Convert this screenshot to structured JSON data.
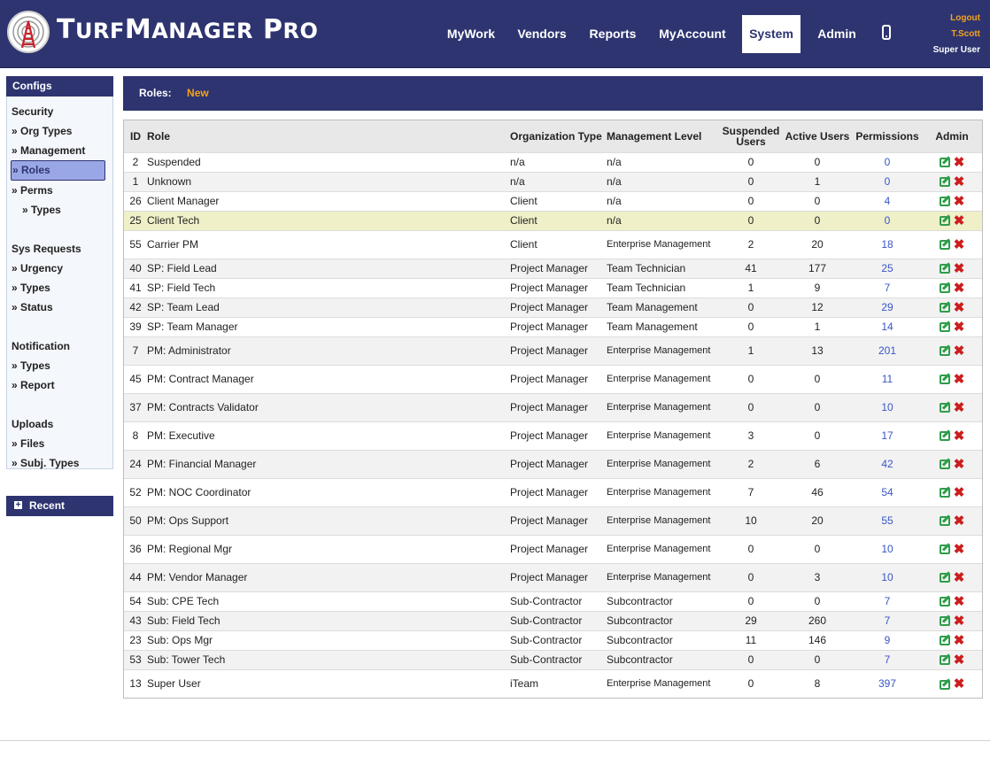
{
  "app": {
    "brand_big1": "T",
    "brand_small1": "URF",
    "brand_big2": "M",
    "brand_small2": "ANAGER",
    "brand_big3": "P",
    "brand_small3": "RO",
    "accent_color": "#f5a21b",
    "nav_bg": "#2d3470"
  },
  "nav": {
    "mywork": "MyWork",
    "vendors": "Vendors",
    "reports": "Reports",
    "myaccount": "MyAccount",
    "system": "System",
    "admin": "Admin",
    "phone_icon": "mobile-phone-icon"
  },
  "user": {
    "logout": "Logout",
    "name": "T.Scott",
    "role": "Super User"
  },
  "sidebar": {
    "header": "Configs",
    "security": "Security",
    "org_types": "» Org Types",
    "management": "» Management",
    "roles": "» Roles",
    "perms": "» Perms",
    "perm_types": "» Types",
    "sys_requests": "Sys Requests",
    "urgency": "» Urgency",
    "req_types": "» Types",
    "status": "» Status",
    "notification": "Notification",
    "notif_types": "» Types",
    "report": "» Report",
    "uploads": "Uploads",
    "files": "» Files",
    "subj_types": "» Subj. Types",
    "recent": "Recent"
  },
  "roles_bar": {
    "label": "Roles:",
    "new": "New"
  },
  "table": {
    "headers": {
      "id": "ID",
      "role": "Role",
      "org_type": "Organization Type",
      "mgmt_level": "Management Level",
      "suspended": "Suspended Users",
      "active": "Active Users",
      "permissions": "Permissions",
      "admin": "Admin"
    },
    "rows": [
      {
        "id": "2",
        "role": "Suspended",
        "org": "n/a",
        "mgmt": "n/a",
        "susp": "0",
        "active": "0",
        "perms": "0"
      },
      {
        "id": "1",
        "role": "Unknown",
        "org": "n/a",
        "mgmt": "n/a",
        "susp": "0",
        "active": "1",
        "perms": "0"
      },
      {
        "id": "26",
        "role": "Client Manager",
        "org": "Client",
        "mgmt": "n/a",
        "susp": "0",
        "active": "0",
        "perms": "4"
      },
      {
        "id": "25",
        "role": "Client Tech",
        "org": "Client",
        "mgmt": "n/a",
        "susp": "0",
        "active": "0",
        "perms": "0"
      },
      {
        "id": "55",
        "role": "Carrier PM",
        "org": "Client",
        "mgmt": "Enterprise Management",
        "susp": "2",
        "active": "20",
        "perms": "18"
      },
      {
        "id": "40",
        "role": "SP: Field Lead",
        "org": "Project Manager",
        "mgmt": "Team Technician",
        "susp": "41",
        "active": "177",
        "perms": "25"
      },
      {
        "id": "41",
        "role": "SP: Field Tech",
        "org": "Project Manager",
        "mgmt": "Team Technician",
        "susp": "1",
        "active": "9",
        "perms": "7"
      },
      {
        "id": "42",
        "role": "SP: Team Lead",
        "org": "Project Manager",
        "mgmt": "Team Management",
        "susp": "0",
        "active": "12",
        "perms": "29"
      },
      {
        "id": "39",
        "role": "SP: Team Manager",
        "org": "Project Manager",
        "mgmt": "Team Management",
        "susp": "0",
        "active": "1",
        "perms": "14"
      },
      {
        "id": "7",
        "role": "PM: Administrator",
        "org": "Project Manager",
        "mgmt": "Enterprise Management",
        "susp": "1",
        "active": "13",
        "perms": "201"
      },
      {
        "id": "45",
        "role": "PM: Contract Manager",
        "org": "Project Manager",
        "mgmt": "Enterprise Management",
        "susp": "0",
        "active": "0",
        "perms": "11"
      },
      {
        "id": "37",
        "role": "PM: Contracts Validator",
        "org": "Project Manager",
        "mgmt": "Enterprise Management",
        "susp": "0",
        "active": "0",
        "perms": "10"
      },
      {
        "id": "8",
        "role": "PM: Executive",
        "org": "Project Manager",
        "mgmt": "Enterprise Management",
        "susp": "3",
        "active": "0",
        "perms": "17"
      },
      {
        "id": "24",
        "role": "PM: Financial Manager",
        "org": "Project Manager",
        "mgmt": "Enterprise Management",
        "susp": "2",
        "active": "6",
        "perms": "42"
      },
      {
        "id": "52",
        "role": "PM: NOC Coordinator",
        "org": "Project Manager",
        "mgmt": "Enterprise Management",
        "susp": "7",
        "active": "46",
        "perms": "54"
      },
      {
        "id": "50",
        "role": "PM: Ops Support",
        "org": "Project Manager",
        "mgmt": "Enterprise Management",
        "susp": "10",
        "active": "20",
        "perms": "55"
      },
      {
        "id": "36",
        "role": "PM: Regional Mgr",
        "org": "Project Manager",
        "mgmt": "Enterprise Management",
        "susp": "0",
        "active": "0",
        "perms": "10"
      },
      {
        "id": "44",
        "role": "PM: Vendor Manager",
        "org": "Project Manager",
        "mgmt": "Enterprise Management",
        "susp": "0",
        "active": "3",
        "perms": "10"
      },
      {
        "id": "54",
        "role": "Sub: CPE Tech",
        "org": "Sub-Contractor",
        "mgmt": "Subcontractor",
        "susp": "0",
        "active": "0",
        "perms": "7"
      },
      {
        "id": "43",
        "role": "Sub: Field Tech",
        "org": "Sub-Contractor",
        "mgmt": "Subcontractor",
        "susp": "29",
        "active": "260",
        "perms": "7"
      },
      {
        "id": "23",
        "role": "Sub: Ops Mgr",
        "org": "Sub-Contractor",
        "mgmt": "Subcontractor",
        "susp": "11",
        "active": "146",
        "perms": "9"
      },
      {
        "id": "53",
        "role": "Sub: Tower Tech",
        "org": "Sub-Contractor",
        "mgmt": "Subcontractor",
        "susp": "0",
        "active": "0",
        "perms": "7"
      },
      {
        "id": "13",
        "role": "Super User",
        "org": "iTeam",
        "mgmt": "Enterprise Management",
        "susp": "0",
        "active": "8",
        "perms": "397"
      }
    ],
    "highlighted_row_index": 3,
    "edit_icon": "edit-icon",
    "delete_icon": "delete-icon"
  }
}
